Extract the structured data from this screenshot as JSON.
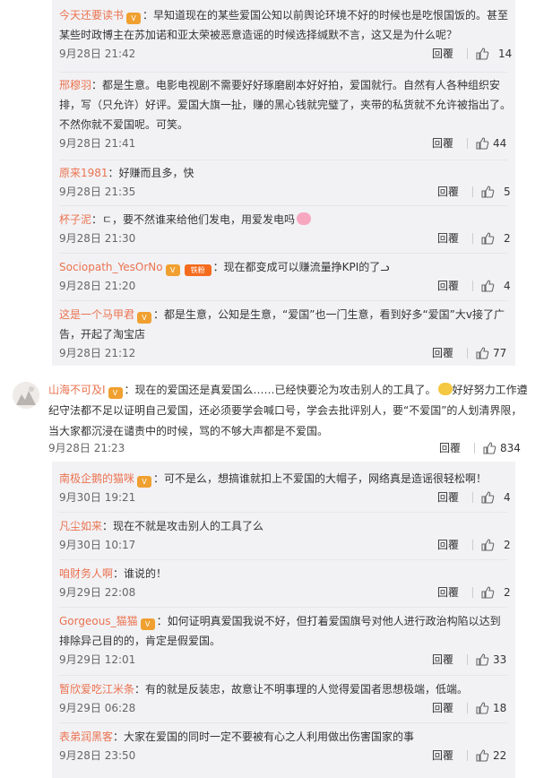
{
  "top_replies": [
    {
      "user": "今天还要读书",
      "badge": true,
      "text": "：早知道现在的某些爱国公知以前舆论环境不好的时候也是吃恨国饭的。甚至某些时政博主在苏加诺和亚太荣被恶意造谣的时候选择缄默不言，这又是为什么呢？",
      "time": "9月28日 21:42",
      "reply": "回覆",
      "likes": "14"
    },
    {
      "user": "邢穆羽",
      "badge": false,
      "text": "：都是生意。电影电视剧不需要好好琢磨剧本好好拍，爱国就行。自然有人各种组织安排，写（只允许）好评。爱国大旗一扯，赚的黑心钱就完璧了，夹带的私货就不允许被指出了。不然你就不爱国呢。可笑。",
      "time": "9月28日 21:41",
      "reply": "回覆",
      "likes": "44"
    },
    {
      "user": "原来1981",
      "badge": false,
      "text": "：好赚而且多，快",
      "time": "9月28日 21:35",
      "reply": "回覆",
      "likes": "5"
    },
    {
      "user": "杯子泥",
      "badge": false,
      "text": "：ㄷ，要不然谁来给他们发电，用爱发电吗",
      "time": "9月28日 21:30",
      "reply": "回覆",
      "likes": "2",
      "emoji": true
    },
    {
      "user": "Sociopath_YesOrNo",
      "badge": true,
      "badge2": "铁粉",
      "text": "：现在都变成可以赚流量挣KPI的了ᓗ",
      "time": "9月28日 21:20",
      "reply": "回覆",
      "likes": "4"
    },
    {
      "user": "这是一个马甲君",
      "badge": true,
      "text": "：都是生意，公知是生意，“爱国”也一门生意，看到好多“爱国”大v接了广告，开起了淘宝店",
      "time": "9月28日 21:12",
      "reply": "回覆",
      "likes": "77"
    }
  ],
  "main_comment": {
    "user": "山海不可及I",
    "badge": true,
    "text": "：现在的爱国还是真爱国么……已经快要沦为攻击别人的工具了。",
    "text2": "好好努力工作遵纪守法都不足以证明自己爱国，还必须要学会喊口号，学会去批评别人，要“不爱国”的人划清界限，当大家都沉浸在谴责中的时候，骂的不够大声都是不爱国。",
    "time": "9月28日 21:23",
    "reply": "回覆",
    "likes": "834"
  },
  "bottom_replies": [
    {
      "user": "南极企鹅的猫咪",
      "badge": true,
      "text": "：可不是么，想搞谁就扣上不爱国的大帽子，网络真是造谣很轻松啊！",
      "time": "9月30日 19:21",
      "reply": "回覆",
      "likes": "4"
    },
    {
      "user": "凡尘如来",
      "badge": false,
      "text": "：现在不就是攻击别人的工具了么",
      "time": "9月30日 10:17",
      "reply": "回覆",
      "likes": "2"
    },
    {
      "user": "咱财务人啊",
      "badge": false,
      "text": "：谁说的！",
      "time": "9月29日 22:08",
      "reply": "回覆",
      "likes": "2"
    },
    {
      "user": "Gorgeous_猫猫",
      "badge": true,
      "text": "：如何证明真爱国我说不好，但打着爱国旗号对他人进行政治构陷以达到排除异己目的的，肯定是假爱国。",
      "time": "9月29日 12:01",
      "reply": "回覆",
      "likes": "33"
    },
    {
      "user": "暂欣爱吃江米条",
      "badge": false,
      "text": "：有的就是反装忠，故意让不明事理的人觉得爱国者思想极端，低端。",
      "time": "9月29日 06:28",
      "reply": "回覆",
      "likes": "18"
    },
    {
      "user": "表弟润黑客",
      "badge": false,
      "text": "：大家在爱国的同时一定不要被有心之人利用做出伤害国家的事",
      "time": "9月28日 23:50",
      "reply": "回覆",
      "likes": "22"
    }
  ],
  "colors": {
    "username": "#eb7350",
    "text": "#333333",
    "meta": "#666666",
    "reply_bg": "#f2f2f5"
  },
  "icons": {
    "like": "thumbs-up-icon",
    "badge": "vip-badge-icon"
  }
}
